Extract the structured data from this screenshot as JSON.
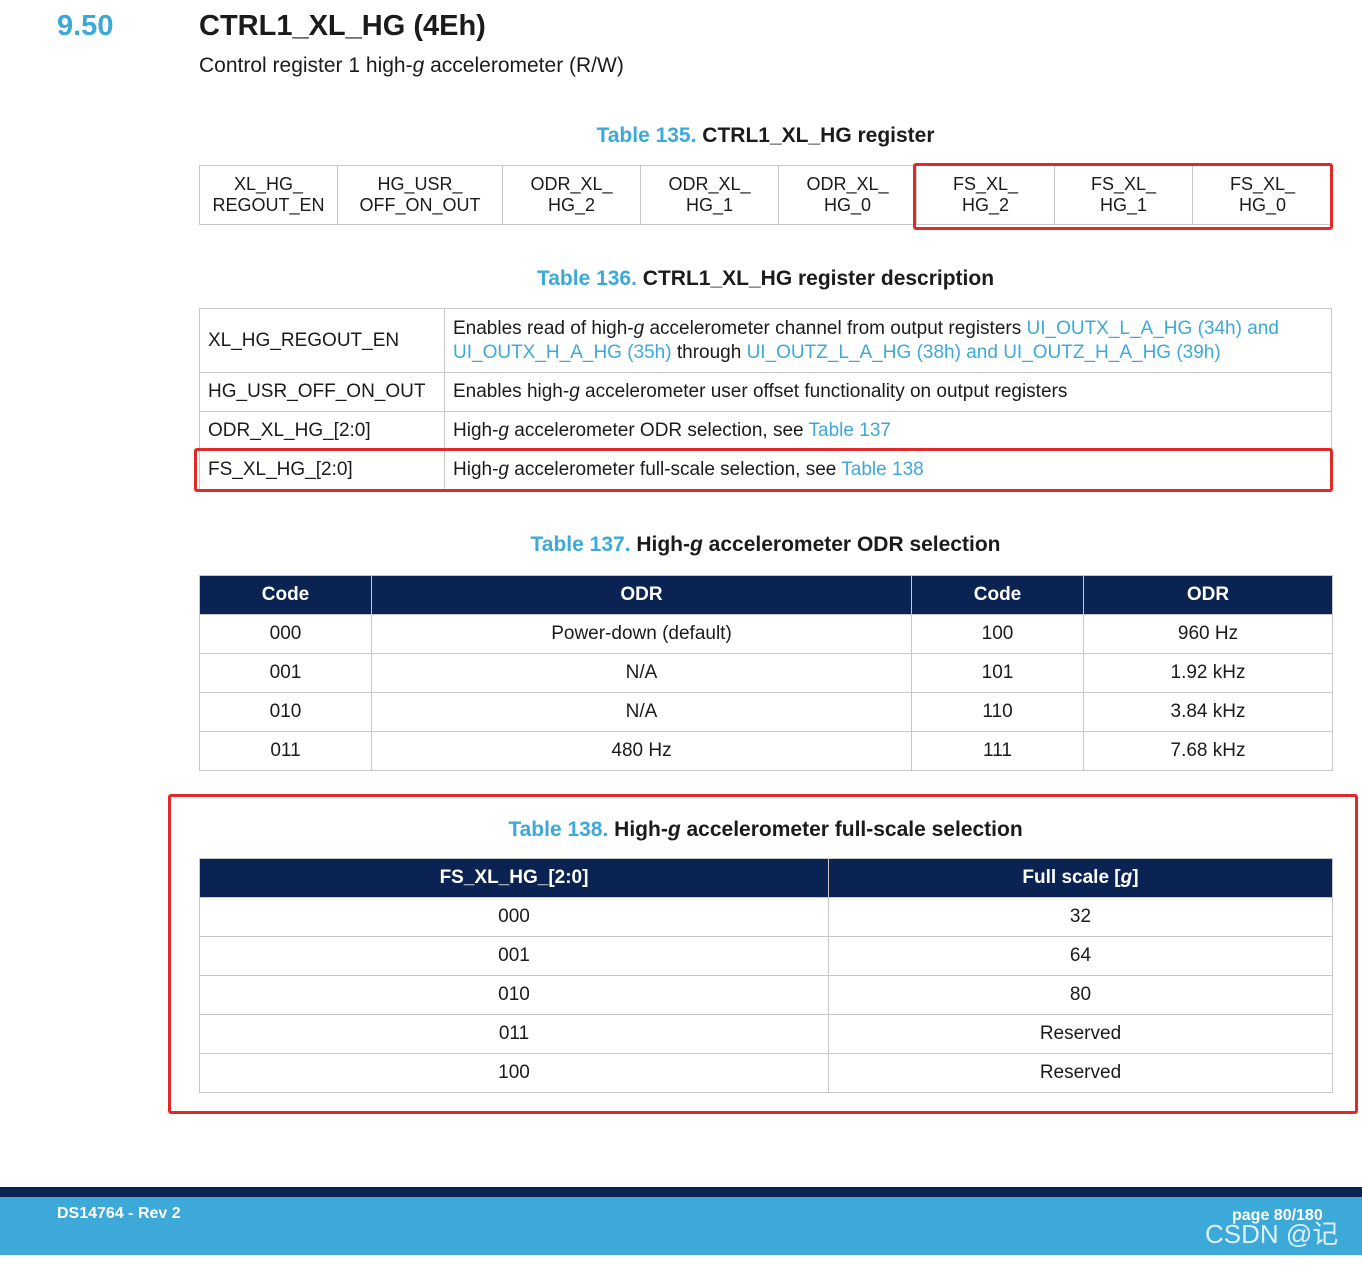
{
  "section": {
    "number": "9.50",
    "title": "CTRL1_XL_HG (4Eh)",
    "subtitle_pre": "Control register 1 high-",
    "subtitle_g": "g",
    "subtitle_post": " accelerometer (R/W)"
  },
  "table135": {
    "num": "Table 135.",
    "title": "CTRL1_XL_HG register",
    "bits": [
      {
        "line1": "XL_HG_",
        "line2": "REGOUT_EN"
      },
      {
        "line1": "HG_USR_",
        "line2": "OFF_ON_OUT"
      },
      {
        "line1": "ODR_XL_",
        "line2": "HG_2"
      },
      {
        "line1": "ODR_XL_",
        "line2": "HG_1"
      },
      {
        "line1": "ODR_XL_",
        "line2": "HG_0"
      },
      {
        "line1": "FS_XL_",
        "line2": "HG_2"
      },
      {
        "line1": "FS_XL_",
        "line2": "HG_1"
      },
      {
        "line1": "FS_XL_",
        "line2": "HG_0"
      }
    ]
  },
  "table136": {
    "num": "Table 136.",
    "title": "CTRL1_XL_HG register description",
    "rows": [
      {
        "key": "XL_HG_REGOUT_EN",
        "t1": "Enables read of high-",
        "g": "g",
        "t2": " accelerometer channel from output registers ",
        "l1": "UI_OUTX_L_A_HG (34h) and UI_OUTX_H_A_HG (35h)",
        "t3": " through ",
        "l2": "UI_OUTZ_L_A_HG (38h) and UI_OUTZ_H_A_HG (39h)"
      },
      {
        "key": "HG_USR_OFF_ON_OUT",
        "t1": "Enables high-",
        "g": "g",
        "t2": " accelerometer user offset functionality on output registers"
      },
      {
        "key": "ODR_XL_HG_[2:0]",
        "t1": "High-",
        "g": "g",
        "t2": " accelerometer ODR selection, see ",
        "l1": "Table 137"
      },
      {
        "key": "FS_XL_HG_[2:0]",
        "t1": "High-",
        "g": "g",
        "t2": " accelerometer full-scale selection, see ",
        "l1": "Table 138"
      }
    ]
  },
  "table137": {
    "num": "Table 137.",
    "title_pre": "High-",
    "title_g": "g",
    "title_post": " accelerometer ODR selection",
    "headers": [
      "Code",
      "ODR",
      "Code",
      "ODR"
    ],
    "rows": [
      [
        "000",
        "Power-down (default)",
        "100",
        "960 Hz"
      ],
      [
        "001",
        "N/A",
        "101",
        "1.92 kHz"
      ],
      [
        "010",
        "N/A",
        "110",
        "3.84 kHz"
      ],
      [
        "011",
        "480 Hz",
        "111",
        "7.68 kHz"
      ]
    ]
  },
  "table138": {
    "num": "Table 138.",
    "title_pre": "High-",
    "title_g": "g",
    "title_post": " accelerometer full-scale selection",
    "header_code": "FS_XL_HG_[2:0]",
    "header_fs_pre": "Full scale [",
    "header_fs_g": "g",
    "header_fs_post": "]",
    "rows": [
      [
        "000",
        "32"
      ],
      [
        "001",
        "64"
      ],
      [
        "010",
        "80"
      ],
      [
        "011",
        "Reserved"
      ],
      [
        "100",
        "Reserved"
      ]
    ]
  },
  "footer": {
    "doc": "DS14764 - Rev 2",
    "page": "page 80/180",
    "watermark": "CSDN @记帖"
  },
  "colors": {
    "accent": "#3ca9d9",
    "header_navy": "#0a2352",
    "highlight_red": "#e02a2a"
  }
}
